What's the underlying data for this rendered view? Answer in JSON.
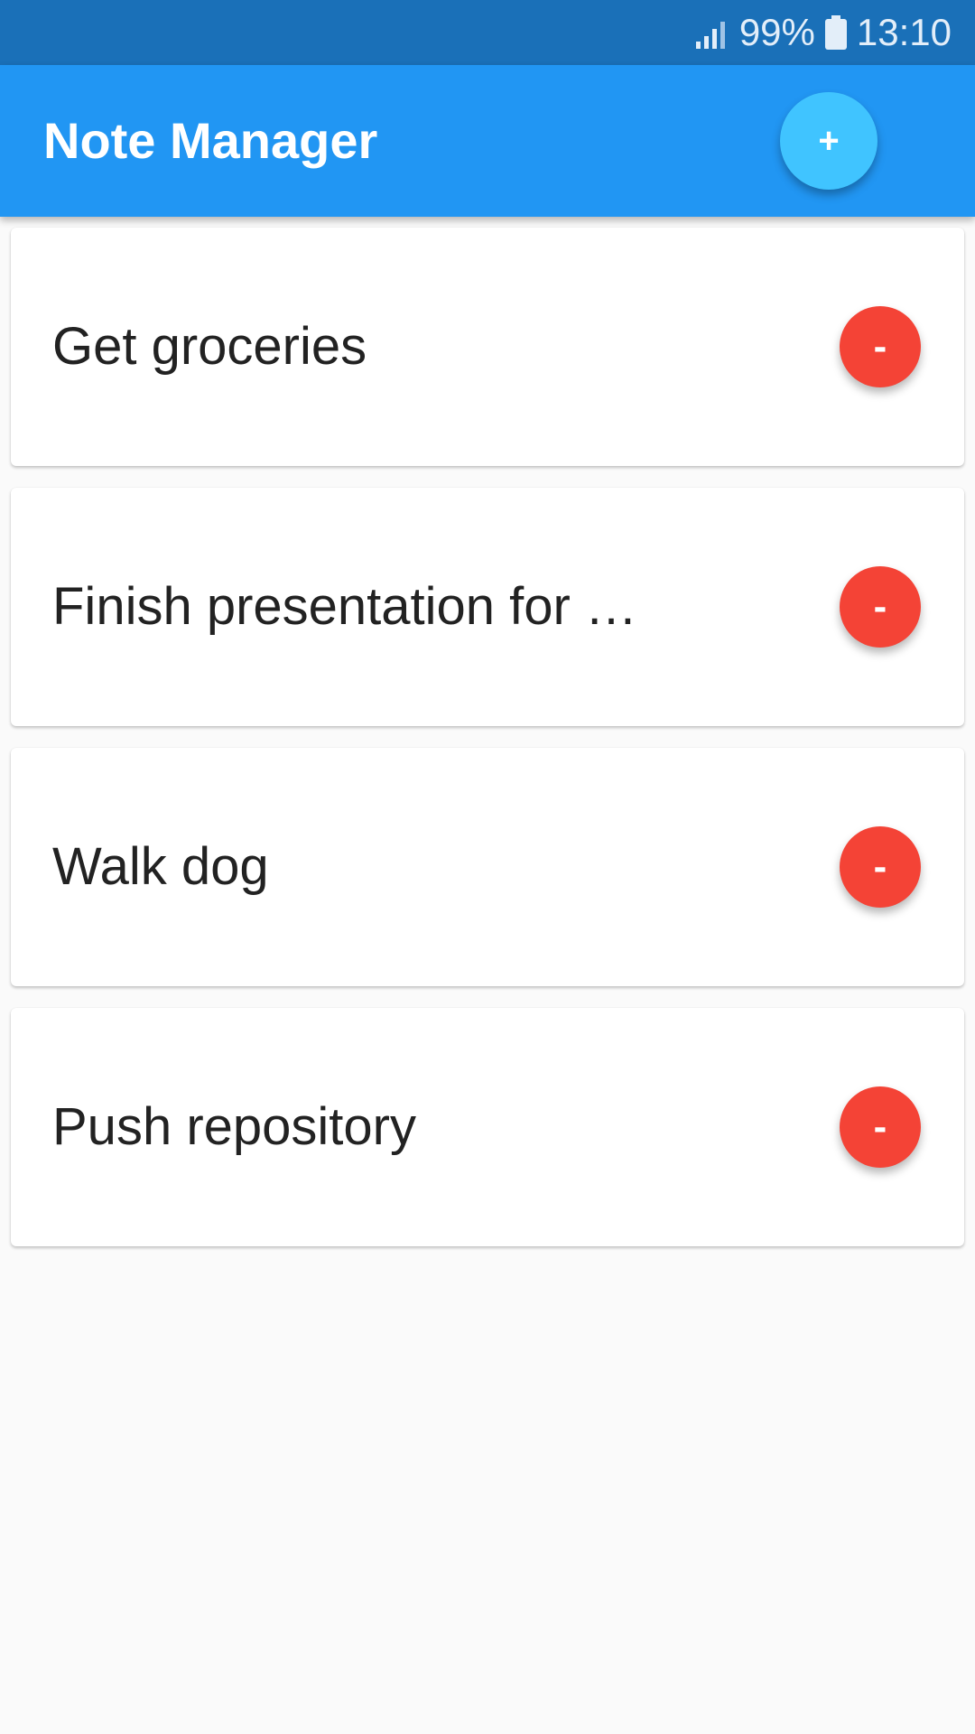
{
  "status_bar": {
    "battery": "99%",
    "time": "13:10",
    "signal_icon": "signal-icon",
    "battery_icon": "battery-icon"
  },
  "app_bar": {
    "title": "Note Manager",
    "add_label": "+",
    "color": "#2196f3",
    "fab_color": "#40c4ff"
  },
  "notes": [
    {
      "text": "Get groceries",
      "delete_label": "-"
    },
    {
      "text": "Finish presentation for …",
      "delete_label": "-"
    },
    {
      "text": "Walk dog",
      "delete_label": "-"
    },
    {
      "text": "Push repository",
      "delete_label": "-"
    }
  ],
  "colors": {
    "status_bar": "#1a70b8",
    "delete_button": "#f44336",
    "background": "#fafafa"
  }
}
